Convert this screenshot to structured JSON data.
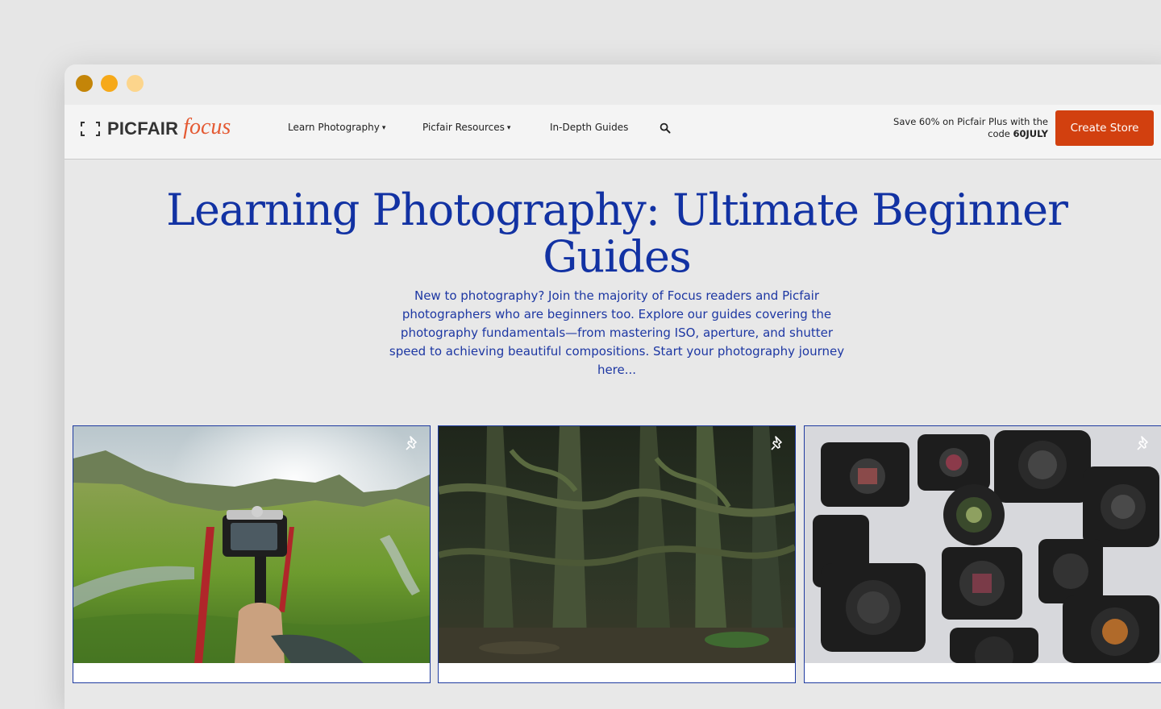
{
  "window": {
    "controls": [
      "close",
      "minimize",
      "maximize"
    ]
  },
  "header": {
    "logo": {
      "brand": "PICFAIR",
      "product": "focus"
    },
    "nav": [
      {
        "label": "Learn Photography",
        "has_dropdown": true,
        "icon": "caret-down-icon"
      },
      {
        "label": "Picfair Resources",
        "has_dropdown": true,
        "icon": "caret-down-icon"
      },
      {
        "label": "In-Depth Guides",
        "has_dropdown": false
      }
    ],
    "search_icon": "search-icon",
    "promo": {
      "text": "Save 60% on Picfair Plus with the code",
      "code": "60JULY"
    },
    "cta_label": "Create Store"
  },
  "hero": {
    "title": "Learning Photography: Ultimate Beginner Guides",
    "description": "New to photography? Join the majority of Focus readers and Picfair photographers who are beginners too. Explore our guides covering the photography fundamentals—from mastering ISO, aperture, and shutter speed to achieving beautiful compositions. Start your photography journey here..."
  },
  "cards": [
    {
      "image": "camera-on-monopod-in-green-valley",
      "pin_icon": "pin-icon"
    },
    {
      "image": "mossy-dark-forest",
      "pin_icon": "pin-icon"
    },
    {
      "image": "assorted-camera-bodies-and-lenses",
      "pin_icon": "pin-icon"
    }
  ],
  "colors": {
    "page_bg": "#e6e6e6",
    "accent": "#d2400f",
    "focus_logo": "#e45a33",
    "hero_text": "#1232a3",
    "card_border": "#1f3ba0",
    "traffic_red": "#c48508",
    "traffic_yellow": "#f6a919",
    "traffic_green": "#fcd58c"
  }
}
